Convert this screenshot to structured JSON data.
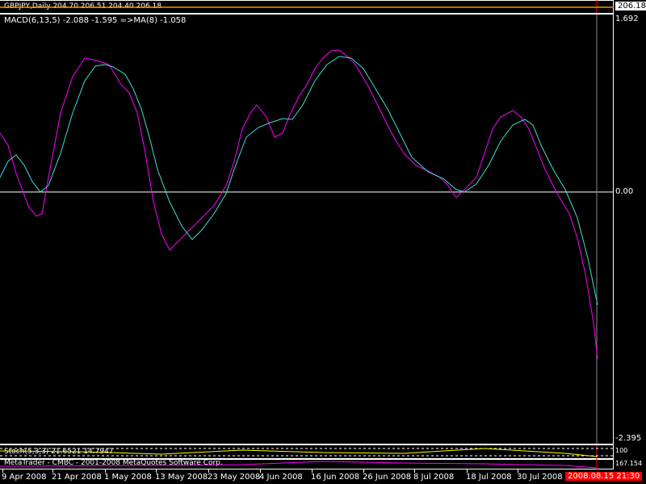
{
  "price_window": {
    "label": "GBPJPY,Daily  204.70 206.51 204.40 206.18",
    "price": "206.18"
  },
  "macd_window": {
    "label": "MACD(6,13,5) -2.088 -1.595  =>MA(8) -1.058",
    "scale": [
      "1.692",
      "0.00",
      "-2.395"
    ]
  },
  "stoch_window": {
    "label": "Stoch(5,3,3) 21.6521 14.7947",
    "scale": [
      "100",
      "0"
    ]
  },
  "bottom_window": {
    "label": "MetaTrader - CMBC - 2001-2008 MetaQuotes Software Corp.",
    "scale": "167.154"
  },
  "time_axis": [
    "9 Apr 2008",
    "21 Apr 2008",
    "1 May 2008",
    "13 May 2008",
    "23 May 2008",
    "4 Jun 2008",
    "16 Jun 2008",
    "26 Jun 2008",
    "8 Jul 2008",
    "18 Jul 2008",
    "30 Jul 2008"
  ],
  "cursor_time": "2008.08.15 21:30",
  "colors": {
    "macd": "#ff00ff",
    "signal": "#40e0d0",
    "cursor": "#ff0000"
  }
}
